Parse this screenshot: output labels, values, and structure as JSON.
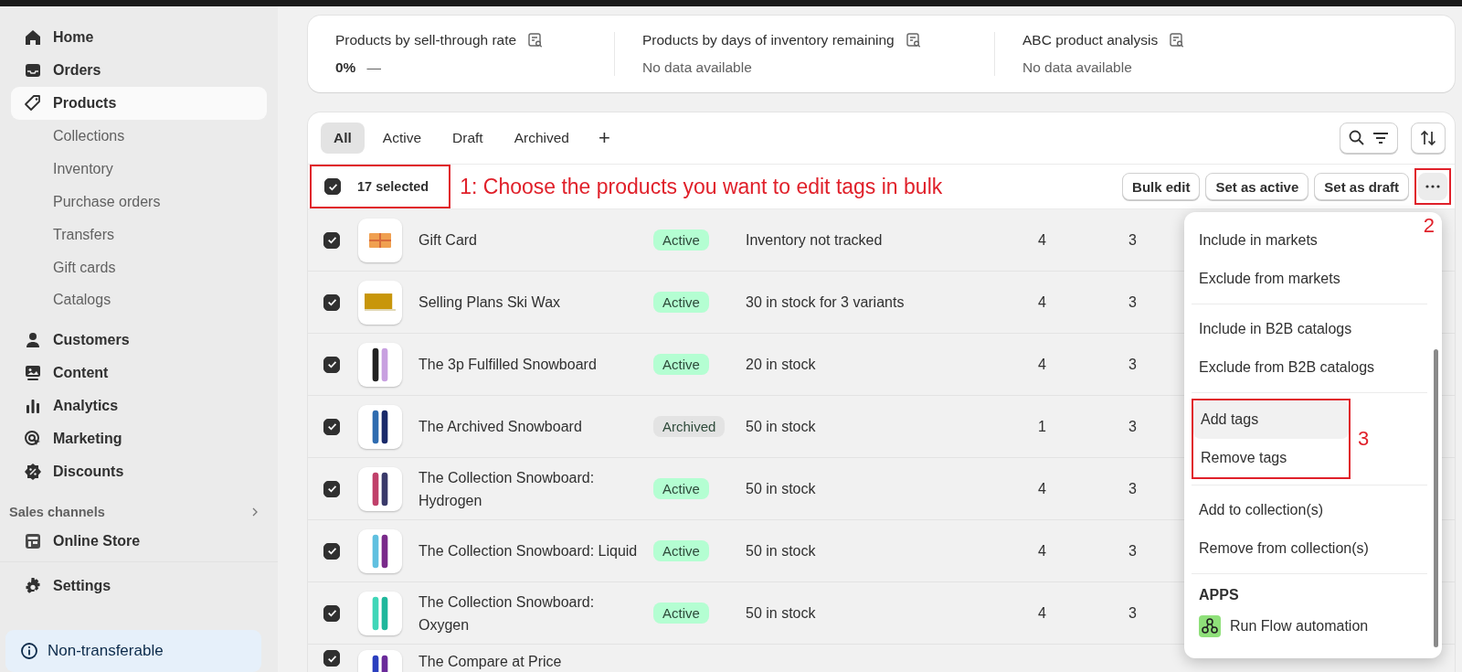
{
  "sidebar": {
    "items": [
      {
        "label": "Home",
        "selected": false
      },
      {
        "label": "Orders",
        "selected": false
      },
      {
        "label": "Products",
        "selected": true,
        "children": [
          {
            "label": "Collections"
          },
          {
            "label": "Inventory"
          },
          {
            "label": "Purchase orders"
          },
          {
            "label": "Transfers"
          },
          {
            "label": "Gift cards"
          },
          {
            "label": "Catalogs"
          }
        ]
      },
      {
        "label": "Customers",
        "selected": false
      },
      {
        "label": "Content",
        "selected": false
      },
      {
        "label": "Analytics",
        "selected": false
      },
      {
        "label": "Marketing",
        "selected": false
      },
      {
        "label": "Discounts",
        "selected": false
      }
    ],
    "sales_channels": {
      "heading": "Sales channels",
      "items": [
        {
          "label": "Online Store",
          "selected": false
        }
      ]
    },
    "settings": {
      "label": "Settings"
    },
    "banner": {
      "label": "Non-transferable"
    }
  },
  "metrics": [
    {
      "title": "Products by sell-through rate",
      "value": "0%",
      "trend": "—",
      "has_data": true
    },
    {
      "title": "Products by days of inventory remaining",
      "value": "No data available",
      "has_data": false
    },
    {
      "title": "ABC product analysis",
      "value": "No data available",
      "has_data": false
    }
  ],
  "tabs": [
    {
      "label": "All",
      "selected": true
    },
    {
      "label": "Active",
      "selected": false
    },
    {
      "label": "Draft",
      "selected": false
    },
    {
      "label": "Archived",
      "selected": false
    }
  ],
  "add_tab": "+",
  "bulk_bar": {
    "checked": true,
    "count": "17 selected",
    "annotation": "1: Choose the products you want to edit tags in bulk",
    "buttons": [
      "Bulk edit",
      "Set as active",
      "Set as draft"
    ],
    "more_annotation": "2"
  },
  "rows": [
    {
      "checked": true,
      "kind": "gift",
      "name": "Gift Card",
      "status": {
        "label": "Active",
        "color": "#b4fed2"
      },
      "inventory": "Inventory not tracked",
      "column_4": "4",
      "column_5": "3"
    },
    {
      "checked": true,
      "kind": "wax",
      "name": "Selling Plans Ski Wax",
      "status": {
        "label": "Active",
        "color": "#b4fed2"
      },
      "inventory": "30 in stock for 3 variants",
      "column_4": "4",
      "column_5": "3"
    },
    {
      "checked": true,
      "kind": "board",
      "name": "The 3p Fulfilled Snowboard",
      "status": {
        "label": "Active",
        "color": "#b4fed2"
      },
      "inventory": "20 in stock",
      "column_4": "4",
      "column_5": "3"
    },
    {
      "checked": true,
      "kind": "board",
      "name": "The Archived Snowboard",
      "status": {
        "label": "Archived",
        "color": "#e3e3e3"
      },
      "inventory": "50 in stock",
      "column_4": "1",
      "column_5": "3"
    },
    {
      "checked": true,
      "kind": "board",
      "name": "The Collection Snowboard: Hydrogen",
      "status": {
        "label": "Active",
        "color": "#b4fed2"
      },
      "inventory": "50 in stock",
      "column_4": "4",
      "column_5": "3"
    },
    {
      "checked": true,
      "kind": "board",
      "name": "The Collection Snowboard: Liquid",
      "status": {
        "label": "Active",
        "color": "#b4fed2"
      },
      "inventory": "50 in stock",
      "column_4": "4",
      "column_5": "3"
    },
    {
      "checked": true,
      "kind": "board",
      "name": "The Collection Snowboard: Oxygen",
      "status": {
        "label": "Active",
        "color": "#b4fed2"
      },
      "inventory": "50 in stock",
      "column_4": "4",
      "column_5": "3"
    },
    {
      "checked": true,
      "kind": "board",
      "name": "The Compare at Price"
    }
  ],
  "menu": {
    "sections": [
      {
        "items": [
          {
            "label": "Include in markets",
            "hovered": false
          },
          {
            "label": "Exclude from markets",
            "hovered": false
          }
        ]
      },
      {
        "items": [
          {
            "label": "Include in B2B catalogs",
            "hovered": false
          },
          {
            "label": "Exclude from B2B catalogs",
            "hovered": false
          }
        ]
      },
      {
        "annotation": "3",
        "items": [
          {
            "label": "Add tags",
            "hovered": true
          },
          {
            "label": "Remove tags",
            "hovered": false
          }
        ]
      },
      {
        "items": [
          {
            "label": "Add to collection(s)",
            "hovered": false
          },
          {
            "label": "Remove from collection(s)",
            "hovered": false
          }
        ]
      },
      {
        "heading": "APPS",
        "items": [
          {
            "label": "Run Flow automation",
            "hovered": false,
            "kind": "app"
          }
        ]
      }
    ]
  }
}
